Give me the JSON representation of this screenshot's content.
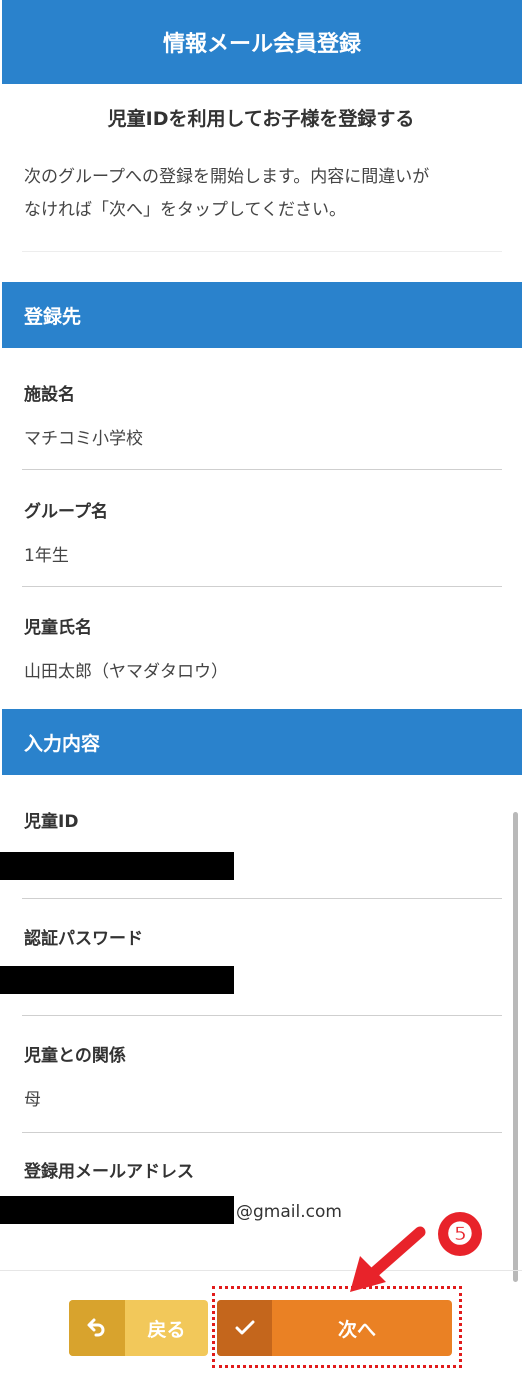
{
  "header": {
    "title": "情報メール会員登録"
  },
  "intro": {
    "subtitle": "児童IDを利用してお子様を登録する",
    "line1": "次のグループへの登録を開始します。内容に間違いが",
    "line2": "なければ「次へ」をタップしてください。"
  },
  "destination": {
    "heading": "登録先",
    "facility_label": "施設名",
    "facility_value": "マチコミ小学校",
    "group_label": "グループ名",
    "group_value": "1年生",
    "child_label": "児童氏名",
    "child_value": "山田太郎（ヤマダタロウ）"
  },
  "input": {
    "heading": "入力内容",
    "id_label": "児童ID",
    "password_label": "認証パスワード",
    "relation_label": "児童との関係",
    "relation_value": "母",
    "email_label": "登録用メールアドレス",
    "email_domain": "@gmail.com"
  },
  "buttons": {
    "back_label": "戻る",
    "next_label": "次へ",
    "back_icon": "return-arrow-icon",
    "next_icon": "checkmark-icon"
  },
  "annotation": {
    "step_number": "❺",
    "color": "#e8232a"
  }
}
